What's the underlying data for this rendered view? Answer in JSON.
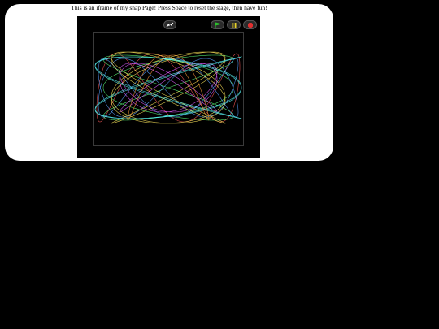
{
  "page": {
    "intro_text": "This is an iframe of my snap Page! Press Space to reset the stage, then have fun!"
  },
  "controls": [
    {
      "name": "fullscreen-button",
      "icon": "expand-icon",
      "color": "#ffffff"
    },
    {
      "name": "go-button",
      "icon": "green-flag-icon",
      "color": "#2dbf2d"
    },
    {
      "name": "pause-button",
      "icon": "pause-icon",
      "color": "#e6d12a"
    },
    {
      "name": "stop-button",
      "icon": "stop-icon",
      "color": "#e03030"
    }
  ],
  "stage": {
    "background": "#000000",
    "stroke_colors": [
      "#ff5a5a",
      "#5aff7a",
      "#5aa0ff",
      "#ffe85a",
      "#e05aff",
      "#5affff",
      "#ff9a3a"
    ]
  }
}
